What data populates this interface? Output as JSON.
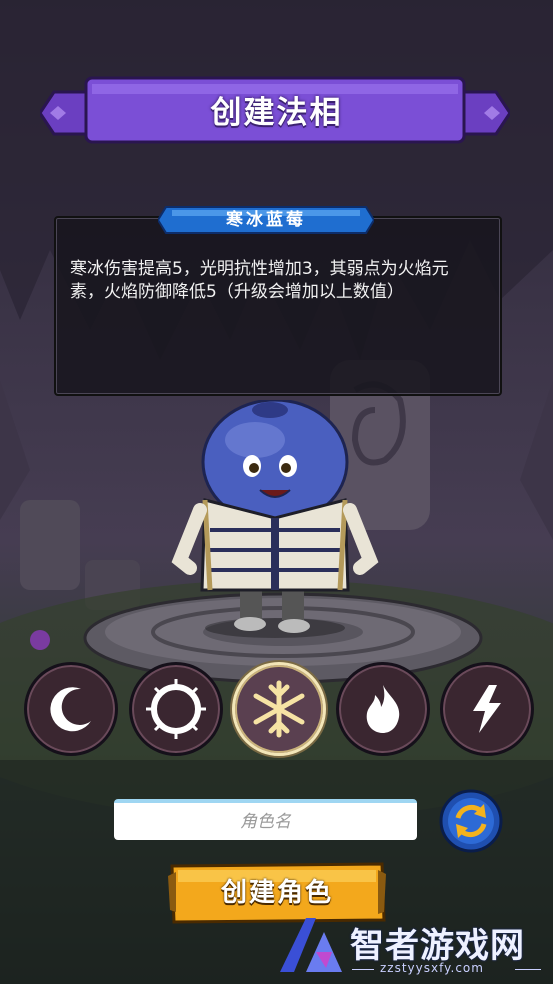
{
  "header": {
    "title": "创建法相"
  },
  "description": {
    "tab_label": "寒冰蓝莓",
    "text": "寒冰伤害提高5，光明抗性增加3，其弱点为火焰元素，火焰防御降低5（升级会增加以上数值）"
  },
  "elements": [
    {
      "name": "moon",
      "icon": "crescent-moon-icon",
      "selected": false
    },
    {
      "name": "light",
      "icon": "sun-ring-icon",
      "selected": false
    },
    {
      "name": "ice",
      "icon": "snowflake-icon",
      "selected": true
    },
    {
      "name": "fire",
      "icon": "flame-icon",
      "selected": false
    },
    {
      "name": "thunder",
      "icon": "lightning-icon",
      "selected": false
    }
  ],
  "name_input": {
    "placeholder": "角色名",
    "value": ""
  },
  "refresh_button": {
    "icon": "refresh-icon"
  },
  "create_button": {
    "label": "创建角色"
  },
  "watermark": {
    "name": "智者游戏网",
    "url": "zzstyysxfy.com"
  },
  "colors": {
    "banner_purple": "#6b3fc1",
    "tab_blue": "#1f6ed0",
    "button_gold": "#f3a81c",
    "selected_ring": "#f3e6b8"
  }
}
